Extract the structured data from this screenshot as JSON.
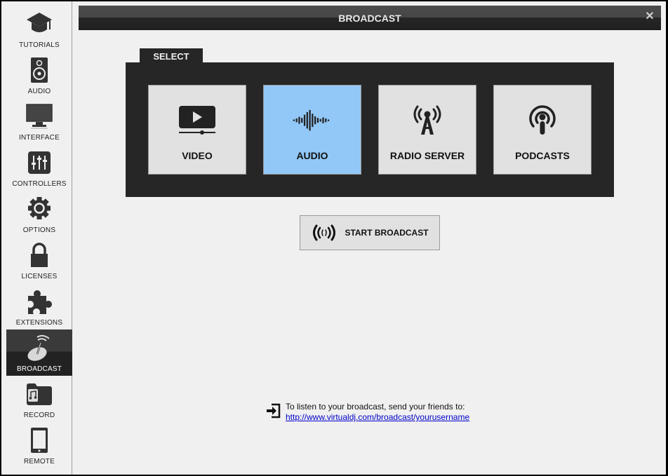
{
  "window": {
    "title": "BROADCAST",
    "close_icon": "close-icon"
  },
  "sidebar": {
    "items": [
      {
        "label": "TUTORIALS",
        "icon": "graduation-cap-icon",
        "active": false
      },
      {
        "label": "AUDIO",
        "icon": "speaker-icon",
        "active": false
      },
      {
        "label": "INTERFACE",
        "icon": "monitor-icon",
        "active": false
      },
      {
        "label": "CONTROLLERS",
        "icon": "sliders-icon",
        "active": false
      },
      {
        "label": "OPTIONS",
        "icon": "gear-icon",
        "active": false
      },
      {
        "label": "LICENSES",
        "icon": "lock-icon",
        "active": false
      },
      {
        "label": "EXTENSIONS",
        "icon": "puzzle-icon",
        "active": false
      },
      {
        "label": "BROADCAST",
        "icon": "satellite-dish-icon",
        "active": true
      },
      {
        "label": "RECORD",
        "icon": "music-folder-icon",
        "active": false
      },
      {
        "label": "REMOTE",
        "icon": "tablet-icon",
        "active": false
      }
    ]
  },
  "select": {
    "tab_label": "SELECT",
    "options": [
      {
        "label": "VIDEO",
        "icon": "video-player-icon",
        "selected": false
      },
      {
        "label": "AUDIO",
        "icon": "waveform-icon",
        "selected": true
      },
      {
        "label": "RADIO SERVER",
        "icon": "radio-tower-icon",
        "selected": false
      },
      {
        "label": "PODCASTS",
        "icon": "podcast-icon",
        "selected": false
      }
    ]
  },
  "start_button": {
    "label": "START BROADCAST",
    "icon": "broadcast-waves-icon"
  },
  "info": {
    "icon": "sign-in-icon",
    "text": "To listen to your broadcast, send your friends to:",
    "link": "http://www.virtualdj.com/broadcast/yourusername"
  },
  "colors": {
    "selected_option": "#92c8f8",
    "panel_dark": "#262626",
    "background": "#f0f0f0",
    "link": "#0000cc"
  }
}
